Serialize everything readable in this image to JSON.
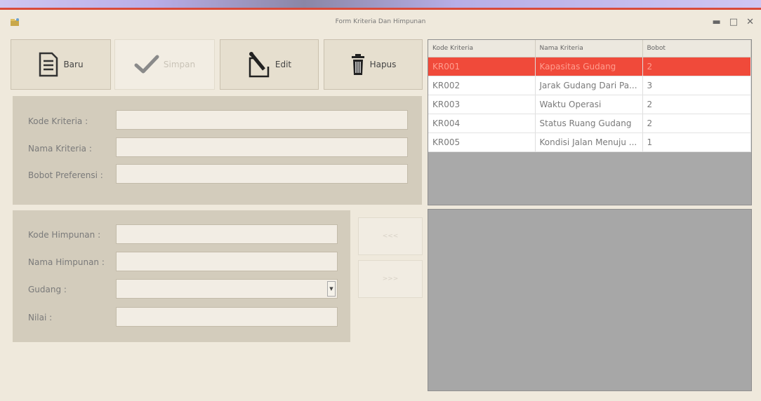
{
  "window": {
    "title": "Form Kriteria Dan Himpunan",
    "controls": [
      "minimize-icon",
      "maximize-icon",
      "close-icon"
    ]
  },
  "toolbar": {
    "baru_label": "Baru",
    "simpan_label": "Simpan",
    "edit_label": "Edit",
    "hapus_label": "Hapus"
  },
  "kriteria_form": {
    "kode_label": "Kode Kriteria :",
    "nama_label": "Nama Kriteria :",
    "bobot_label": "Bobot Preferensi :",
    "kode_value": "",
    "nama_value": "",
    "bobot_value": ""
  },
  "himpunan_form": {
    "kode_label": "Kode Himpunan :",
    "nama_label": "Nama Himpunan :",
    "gudang_label": "Gudang :",
    "nilai_label": "Nilai :",
    "kode_value": "",
    "nama_value": "",
    "gudang_value": "",
    "nilai_value": ""
  },
  "side_buttons": {
    "add_label": "<<<",
    "remove_label": ">>>"
  },
  "kriteria_table": {
    "columns": [
      "Kode Kriteria",
      "Nama Kriteria",
      "Bobot"
    ],
    "rows": [
      [
        "KR001",
        "Kapasitas Gudang",
        "2"
      ],
      [
        "KR002",
        "Jarak Gudang Dari Pa...",
        "3"
      ],
      [
        "KR003",
        "Waktu Operasi",
        "2"
      ],
      [
        "KR004",
        "Status Ruang Gudang",
        "2"
      ],
      [
        "KR005",
        "Kondisi Jalan Menuju ...",
        "1"
      ]
    ],
    "selected_index": 0,
    "selected_color": "#f04a3a"
  }
}
